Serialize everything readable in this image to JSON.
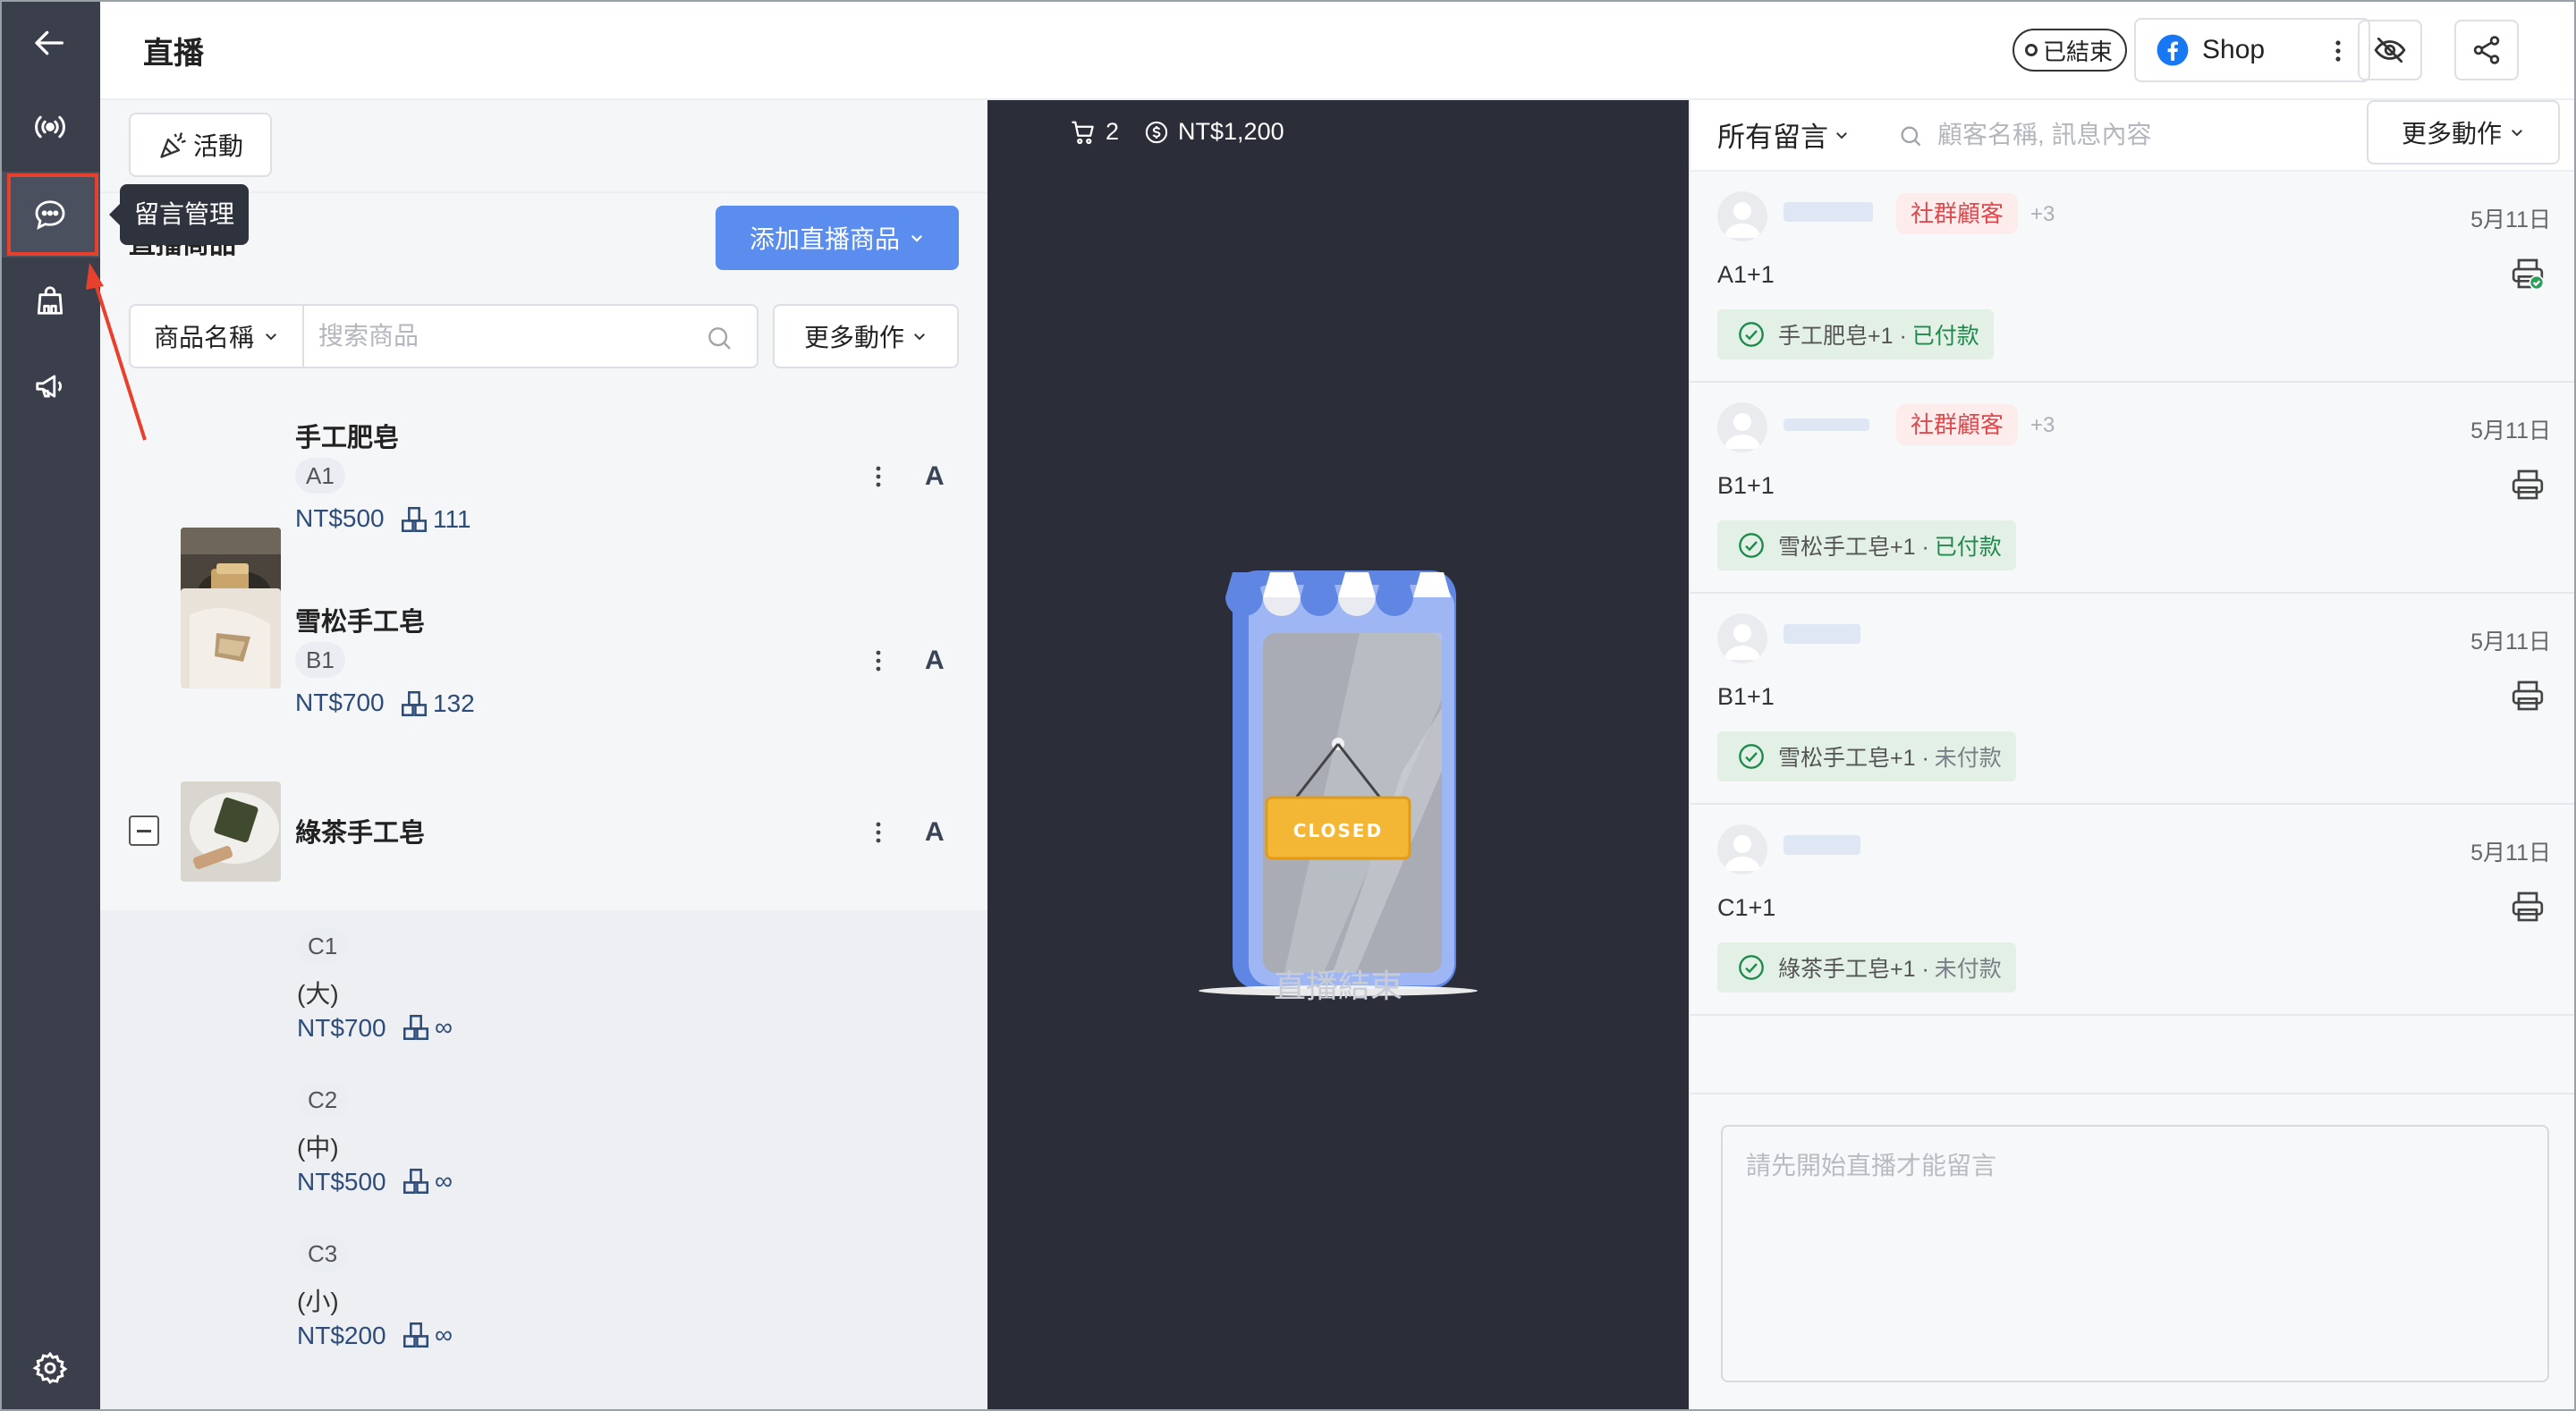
{
  "header": {
    "title": "直播",
    "status_label": "已結束",
    "channel_label": "Shop"
  },
  "sidebar": {
    "tooltip": "留言管理",
    "items": [
      {
        "icon": "arrow-left-icon"
      },
      {
        "icon": "live-broadcast-icon"
      },
      {
        "icon": "chat-bubble-icon"
      },
      {
        "icon": "shop-bag-icon"
      },
      {
        "icon": "megaphone-icon"
      },
      {
        "icon": "gear-icon"
      }
    ]
  },
  "products": {
    "activity_label": "活動",
    "section_title": "直播商品",
    "add_button_label": "添加直播商品",
    "search_field_label": "商品名稱",
    "search_placeholder": "搜索商品",
    "more_actions_label": "更多動作",
    "items": [
      {
        "name": "手工肥皂",
        "code": "A1",
        "price": "NT$500",
        "stock": "111",
        "letter": "A"
      },
      {
        "name": "雪松手工皂",
        "code": "B1",
        "price": "NT$700",
        "stock": "132",
        "letter": "A"
      },
      {
        "name": "綠茶手工皂",
        "letter": "A",
        "variants": [
          {
            "code": "C1",
            "label": "(大)",
            "price": "NT$700",
            "stock": "∞"
          },
          {
            "code": "C2",
            "label": "(中)",
            "price": "NT$500",
            "stock": "∞"
          },
          {
            "code": "C3",
            "label": "(小)",
            "price": "NT$200",
            "stock": "∞"
          }
        ]
      }
    ]
  },
  "live": {
    "cart_count": "2",
    "total_amount": "NT$1,200",
    "closed_sign": "CLOSED",
    "ended_text": "直播結束"
  },
  "comments": {
    "filter_label": "所有留言",
    "search_placeholder": "顧客名稱, 訊息內容",
    "more_actions_label": "更多動作",
    "composer_placeholder": "請先開始直播才能留言",
    "items": [
      {
        "tag": "社群顧客",
        "extra": "+3",
        "date": "5月11日",
        "text": "A1+1",
        "order": "手工肥皂+1 ·",
        "status": "已付款"
      },
      {
        "tag": "社群顧客",
        "extra": "+3",
        "date": "5月11日",
        "text": "B1+1",
        "order": "雪松手工皂+1 ·",
        "status": "已付款"
      },
      {
        "date": "5月11日",
        "text": "B1+1",
        "order": "雪松手工皂+1 ·",
        "status": "未付款"
      },
      {
        "date": "5月11日",
        "text": "C1+1",
        "order": "綠茶手工皂+1 ·",
        "status": "未付款"
      }
    ]
  },
  "colors": {
    "accent": "#5b8def",
    "rail": "#3a3f4b",
    "live_bg": "#2b2e39",
    "highlight": "#e8402c",
    "paid": "#1f8a4c"
  }
}
